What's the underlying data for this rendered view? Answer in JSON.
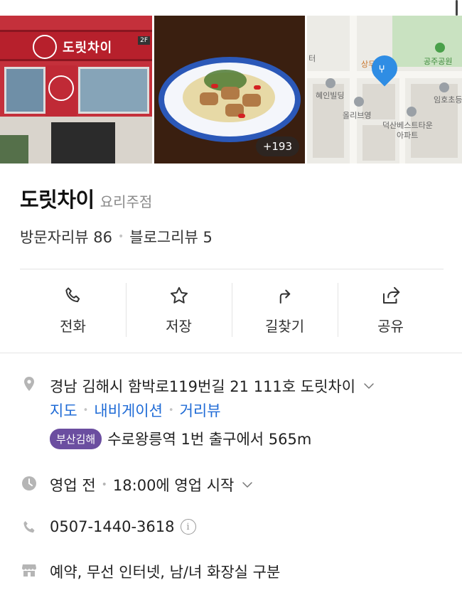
{
  "photos": {
    "store_sign_text": "도릿차이",
    "store_floor_tag": "2F",
    "photo_count": "+193"
  },
  "map": {
    "labels": {
      "park": "공주공원",
      "building1": "혜인빌딩",
      "store": "올리브영",
      "apt": "덕산베스트타운",
      "apt2": "아파트",
      "school": "임호초등",
      "top": "상무",
      "left": "터"
    }
  },
  "place": {
    "name": "도릿차이",
    "category": "요리주점",
    "visitor_reviews": "방문자리뷰 86",
    "blog_reviews": "블로그리뷰 5"
  },
  "actions": [
    {
      "label": "전화",
      "icon": "phone-icon"
    },
    {
      "label": "저장",
      "icon": "star-icon"
    },
    {
      "label": "길찾기",
      "icon": "directions-icon"
    },
    {
      "label": "공유",
      "icon": "share-icon"
    }
  ],
  "info": {
    "address": "경남 김해시 함박로119번길 21 111호 도릿차이",
    "links": [
      "지도",
      "내비게이션",
      "거리뷰"
    ],
    "subway_line": "부산김해",
    "subway_text": "수로왕릉역 1번 출구에서 565m",
    "hours_status": "영업 전",
    "hours_detail": "18:00에 영업 시작",
    "phone": "0507-1440-3618",
    "amenities": "예약, 무선 인터넷, 남/녀 화장실 구분"
  },
  "colors": {
    "link": "#1f6bd6",
    "badge": "#6b4ea0",
    "pin": "#2f8de4"
  }
}
